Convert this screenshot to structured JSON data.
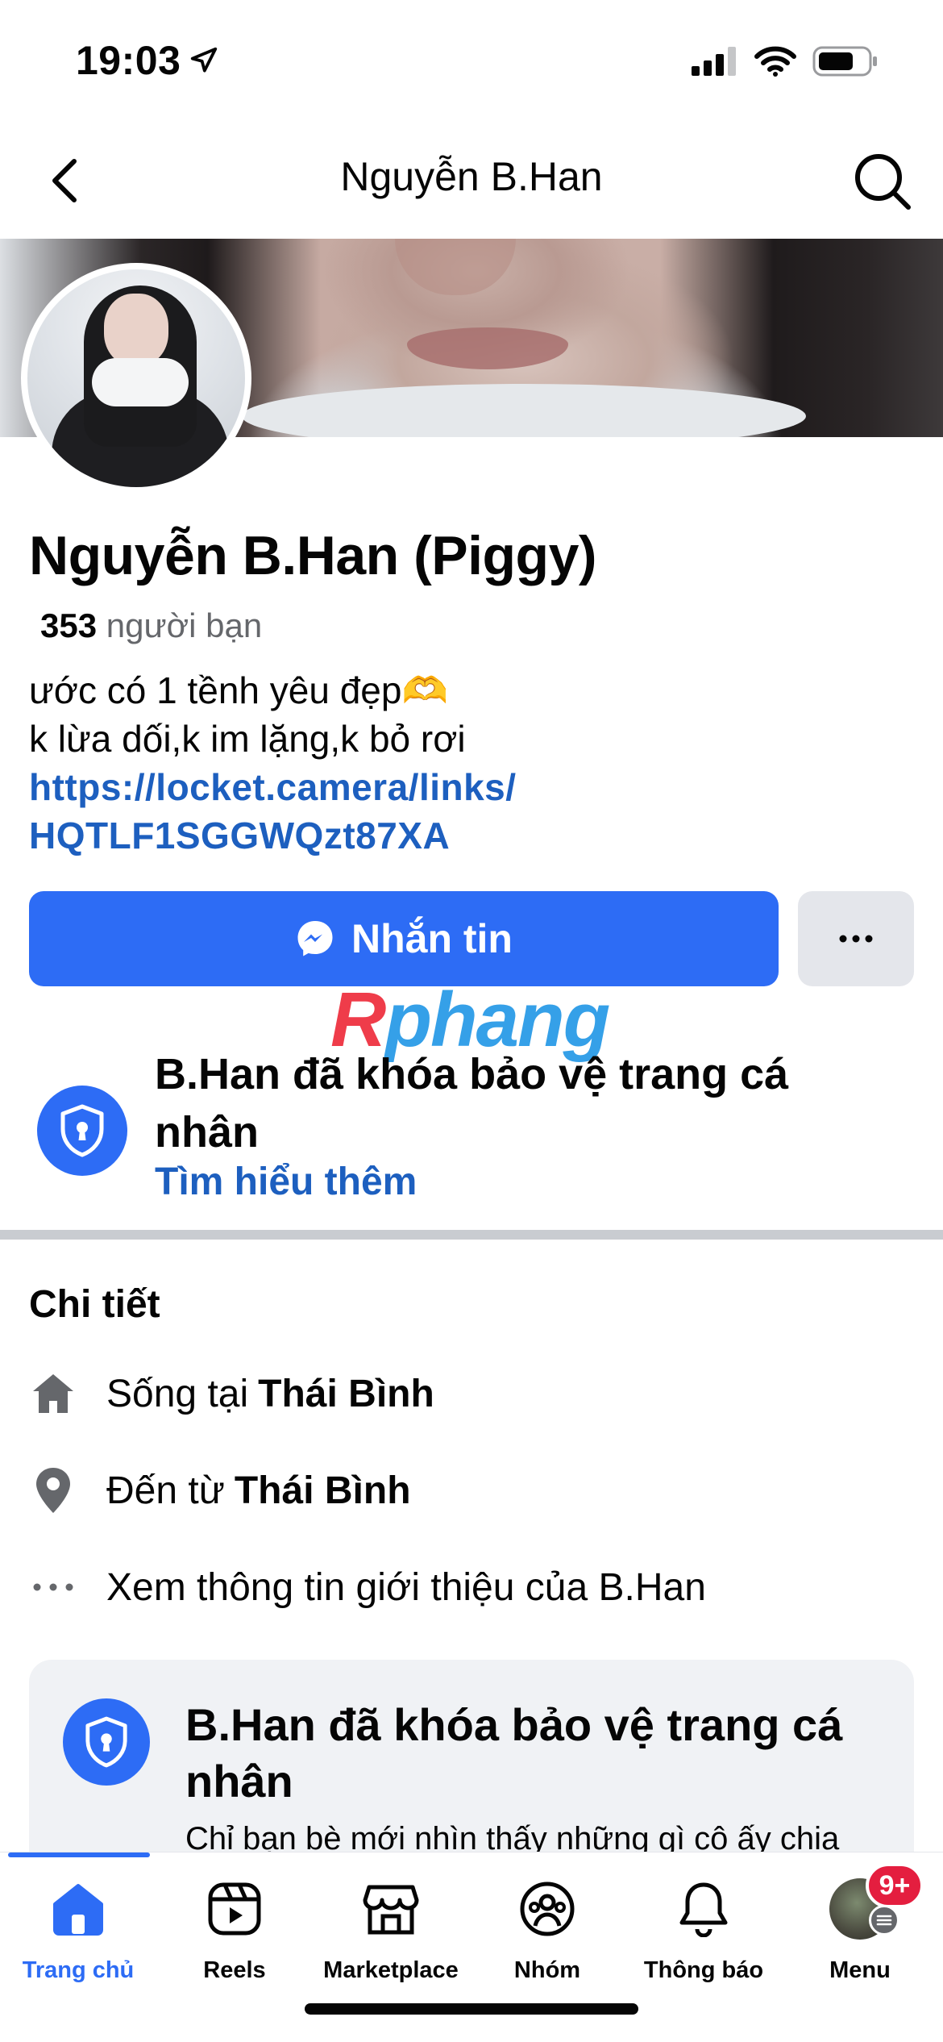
{
  "status_bar": {
    "time": "19:03",
    "icons": [
      "location-arrow-icon",
      "signal-icon",
      "wifi-icon",
      "battery-icon"
    ]
  },
  "header": {
    "title": "Nguyễn B.Han",
    "back_icon": "chevron-left-icon",
    "search_icon": "search-icon"
  },
  "profile": {
    "name": "Nguyễn B.Han (Piggy)",
    "friends_count": "353",
    "friends_label": "người bạn",
    "bio_line1": "ước có 1 tềnh yêu đẹp🫶",
    "bio_line2": "k lừa dối,k im lặng,k bỏ rơi",
    "link_line1": "https://locket.camera/links/",
    "link_line2": "HQTLF1SGGWQzt87XA"
  },
  "actions": {
    "message_label": "Nhắn tin",
    "more_label": "···"
  },
  "watermark": {
    "first": "R",
    "rest": "phang"
  },
  "lock_notice": {
    "title": "B.Han đã khóa bảo vệ trang cá nhân",
    "link": "Tìm hiểu thêm"
  },
  "details": {
    "title": "Chi tiết",
    "lives_prefix": "Sống tại",
    "lives_value": "Thái Bình",
    "from_prefix": "Đến từ",
    "from_value": "Thái Bình",
    "about_label": "Xem thông tin giới thiệu của B.Han"
  },
  "card": {
    "title": "B.Han đã khóa bảo vệ trang cá nhân",
    "subtitle": "Chỉ bạn bè mới nhìn thấy những gì cô ấy chia"
  },
  "bottom_nav": {
    "items": [
      {
        "label": "Trang chủ",
        "icon": "home-icon",
        "active": true
      },
      {
        "label": "Reels",
        "icon": "reels-icon",
        "active": false
      },
      {
        "label": "Marketplace",
        "icon": "marketplace-icon",
        "active": false
      },
      {
        "label": "Nhóm",
        "icon": "groups-icon",
        "active": false
      },
      {
        "label": "Thông báo",
        "icon": "bell-icon",
        "active": false
      },
      {
        "label": "Menu",
        "icon": "menu-avatar",
        "active": false
      }
    ],
    "menu_badge": "9+"
  },
  "colors": {
    "accent": "#2d6cf5",
    "link": "#1d5fbf",
    "badge": "#e41e3f"
  }
}
